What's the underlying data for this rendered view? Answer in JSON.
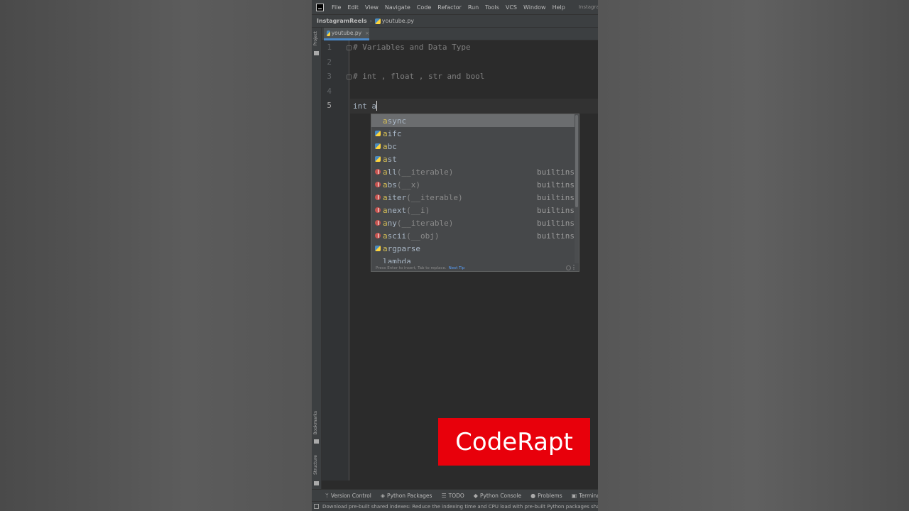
{
  "menubar": {
    "items": [
      "File",
      "Edit",
      "View",
      "Navigate",
      "Code",
      "Refactor",
      "Run",
      "Tools",
      "VCS",
      "Window",
      "Help"
    ],
    "window_title": "InstagramReels - yout"
  },
  "breadcrumb": {
    "project": "InstagramReels",
    "file": "youtube.py"
  },
  "left_strip": {
    "top_label": "Project",
    "bookmarks_label": "Bookmarks",
    "structure_label": "Structure"
  },
  "editor_tab": {
    "label": "youtube.py",
    "close": "×"
  },
  "editor": {
    "line_numbers": [
      "1",
      "2",
      "3",
      "4",
      "5"
    ],
    "lines": [
      "# Variables and Data Type",
      "",
      "# int , float , str and bool",
      "",
      "int a"
    ]
  },
  "completion": {
    "items": [
      {
        "icon": "none",
        "name": "async",
        "params": "",
        "tail": ""
      },
      {
        "icon": "python-module-icon",
        "name": "aifc",
        "params": "",
        "tail": ""
      },
      {
        "icon": "python-module-icon",
        "name": "abc",
        "params": "",
        "tail": ""
      },
      {
        "icon": "python-module-icon",
        "name": "ast",
        "params": "",
        "tail": ""
      },
      {
        "icon": "function-icon",
        "name": "all",
        "params": "(__iterable)",
        "tail": "builtins"
      },
      {
        "icon": "function-icon",
        "name": "abs",
        "params": "(__x)",
        "tail": "builtins"
      },
      {
        "icon": "function-icon",
        "name": "aiter",
        "params": "(__iterable)",
        "tail": "builtins"
      },
      {
        "icon": "function-icon",
        "name": "anext",
        "params": "(__i)",
        "tail": "builtins"
      },
      {
        "icon": "function-icon",
        "name": "any",
        "params": "(__iterable)",
        "tail": "builtins"
      },
      {
        "icon": "function-icon",
        "name": "ascii",
        "params": "(__obj)",
        "tail": "builtins"
      },
      {
        "icon": "python-module-icon",
        "name": "argparse",
        "params": "",
        "tail": ""
      },
      {
        "icon": "none",
        "name": "lambda",
        "params": "",
        "tail": ""
      }
    ],
    "footer_hint": "Press Enter to insert, Tab to replace.",
    "footer_tip": "Next Tip"
  },
  "tool_windows": [
    {
      "icon": "vcs-icon",
      "glyph": "ᛘ",
      "label": "Version Control"
    },
    {
      "icon": "packages-icon",
      "glyph": "◈",
      "label": "Python Packages"
    },
    {
      "icon": "todo-icon",
      "glyph": "☰",
      "label": "TODO"
    },
    {
      "icon": "console-icon",
      "glyph": "◆",
      "label": "Python Console"
    },
    {
      "icon": "problems-icon",
      "glyph": "●",
      "label": "Problems"
    },
    {
      "icon": "terminal-icon",
      "glyph": "▣",
      "label": "Terminal"
    }
  ],
  "status": {
    "message": "Download pre-built shared indexes: Reduce the indexing time and CPU load with pre-built Python packages shared i"
  },
  "brand": {
    "text": "CodeRapt",
    "color": "#e8000b"
  }
}
